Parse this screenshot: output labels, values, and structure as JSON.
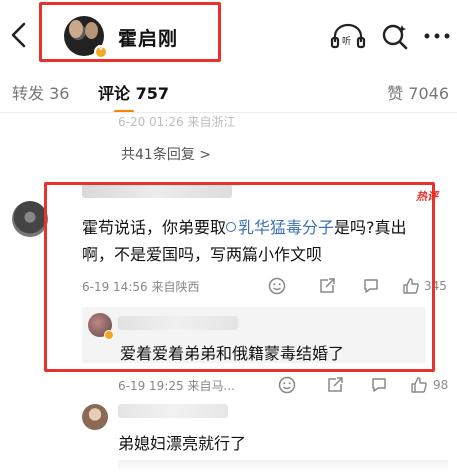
{
  "header": {
    "user_name": "霍启刚"
  },
  "tabs": {
    "repost": "转发 36",
    "comment": "评论 757",
    "like": "赞 7046"
  },
  "feed": {
    "faded_meta": "6-20 01:26 来自浙江",
    "replies_link": "共41条回复 >",
    "comment1": {
      "hot_tag": "热评",
      "text_before": "霍苟说话，你弟要取",
      "link_text": "乳华猛毒分子",
      "text_after": "是吗?真出啊，不是爱国吗，写两篇小作文呗",
      "meta": "6-19 14:56 来自陕西",
      "like_count": "345"
    },
    "reply": {
      "text": "爱着爱着弟弟和俄籍蒙毒结婚了"
    },
    "comment2": {
      "meta": "6-19 19:25 来自马...",
      "like_count": "98"
    },
    "comment3": {
      "text": "弟媳妇漂亮就行了"
    }
  },
  "colors": {
    "highlight_box": "#e8322b",
    "link": "#3b6fb6",
    "tab_underline": "#ff8200",
    "verified_badge": "#f6a623"
  },
  "icons": [
    "back-arrow-icon",
    "listen-icon",
    "search-sparkle-icon",
    "more-dots-icon",
    "emoji-icon",
    "reply-icon",
    "comment-icon",
    "like-icon"
  ]
}
